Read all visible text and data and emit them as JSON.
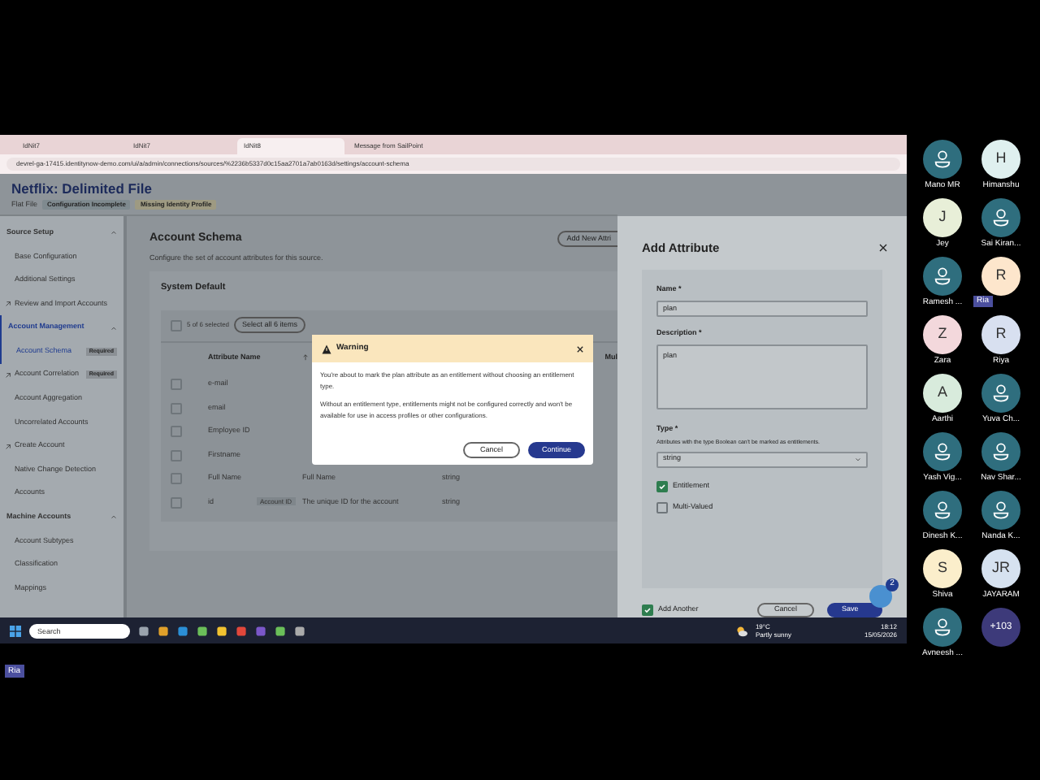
{
  "browser": {
    "tabs": [
      {
        "label": "IdNit7",
        "selected": false
      },
      {
        "label": "IdNit7",
        "selected": false
      },
      {
        "label": "IdNit8",
        "selected": true
      },
      {
        "label": "Message from SailPoint",
        "selected": false
      }
    ],
    "url": "devrel-ga-17415.identitynow-demo.com/ui/a/admin/connections/sources/%2236b5337d0c15aa2701a7ab0163d/settings/account-schema"
  },
  "source": {
    "title": "Netflix: Delimited File",
    "type": "Flat File",
    "badges": [
      "Configuration Incomplete",
      "Missing Identity Profile"
    ]
  },
  "sidebar": {
    "items": [
      {
        "kind": "section",
        "label": "Source Setup",
        "selected": false
      },
      {
        "kind": "link",
        "label": "Base Configuration",
        "selected": false
      },
      {
        "kind": "link",
        "label": "Additional Settings",
        "selected": false
      },
      {
        "kind": "action",
        "label": "Review and Import Accounts",
        "selected": false
      },
      {
        "kind": "section",
        "label": "Account Management",
        "selected": true
      },
      {
        "kind": "link",
        "label": "Account Schema",
        "selected": true,
        "badge": "Required"
      },
      {
        "kind": "action",
        "label": "Account Correlation",
        "selected": false,
        "badge": "Required"
      },
      {
        "kind": "link",
        "label": "Account Aggregation",
        "selected": false
      },
      {
        "kind": "link",
        "label": "Uncorrelated Accounts",
        "selected": false
      },
      {
        "kind": "action",
        "label": "Create Account",
        "selected": false
      },
      {
        "kind": "link",
        "label": "Native Change Detection",
        "selected": false
      },
      {
        "kind": "link",
        "label": "Accounts",
        "selected": false
      },
      {
        "kind": "section",
        "label": "Machine Accounts",
        "selected": false
      },
      {
        "kind": "link",
        "label": "Account Subtypes",
        "selected": false
      },
      {
        "kind": "link",
        "label": "Classification",
        "selected": false
      },
      {
        "kind": "link",
        "label": "Mappings",
        "selected": false
      }
    ]
  },
  "schema": {
    "title": "Account Schema",
    "description": "Configure the set of account attributes for this source.",
    "add_button": "Add New Attri",
    "card_title": "System Default",
    "selection": "5 of 6 selected",
    "all_checked": false,
    "select_all": "Select all 6 items",
    "columns": [
      "Attribute Name",
      "Mul"
    ],
    "rows": [
      {
        "name": "e-mail",
        "checked": false
      },
      {
        "name": "email",
        "checked": false
      },
      {
        "name": "Employee ID",
        "checked": false
      },
      {
        "name": "Firstname",
        "checked": false
      },
      {
        "name": "Full Name",
        "description": "Full Name",
        "type": "string",
        "checked": false
      },
      {
        "name": "id",
        "badge": "Account ID",
        "description": "The unique ID for the account",
        "type": "string",
        "checked": false
      }
    ]
  },
  "warning": {
    "title": "Warning",
    "paragraphs": [
      "You're about to mark the plan attribute as an entitlement without choosing an entitlement type.",
      "Without an entitlement type, entitlements might not be configured correctly and won't be available for use in access profiles or other configurations."
    ],
    "cancel": "Cancel",
    "continue": "Continue"
  },
  "panel": {
    "title": "Add Attribute",
    "name_label": "Name *",
    "name_value": "plan",
    "description_label": "Description *",
    "description_value": "plan",
    "type_label": "Type *",
    "type_hint": "Attributes with the type Boolean can't be marked as entitlements.",
    "type_value": "string",
    "options": [
      {
        "label": "Entitlement",
        "checked": true
      },
      {
        "label": "Multi-Valued",
        "checked": false
      }
    ],
    "add_another": {
      "label": "Add Another",
      "checked": true
    },
    "cancel": "Cancel",
    "save": "Save",
    "help_count": "2"
  },
  "taskbar": {
    "search_placeholder": "Search",
    "weather": "19°C",
    "weather_note": "Partly sunny",
    "time": "18:12",
    "date": "15/05/2026"
  },
  "participants": [
    {
      "kind": "avatar",
      "name": "Mano MR"
    },
    {
      "kind": "initial",
      "name": "Himanshu",
      "initial": "H",
      "color": "#dff0ef"
    },
    {
      "kind": "initial",
      "name": "Jey",
      "initial": "J",
      "color": "#e8efd8"
    },
    {
      "kind": "avatar",
      "name": "Sai Kiran..."
    },
    {
      "kind": "avatar",
      "name": "Ramesh ..."
    },
    {
      "kind": "initial",
      "initial": "R",
      "color": "#fde6cc",
      "tag": "Ria"
    },
    {
      "kind": "initial",
      "name": "Zara",
      "initial": "Z",
      "color": "#f3d8dc"
    },
    {
      "kind": "initial",
      "name": "Riya",
      "initial": "R",
      "color": "#d8e0f0"
    },
    {
      "kind": "initial",
      "name": "Aarthi",
      "initial": "A",
      "color": "#d8ebdc"
    },
    {
      "kind": "avatar",
      "name": "Yuva Ch..."
    },
    {
      "kind": "avatar",
      "name": "Yash Vig..."
    },
    {
      "kind": "avatar",
      "name": "Nav Shar..."
    },
    {
      "kind": "avatar",
      "name": "Dinesh K..."
    },
    {
      "kind": "avatar",
      "name": "Nanda K..."
    },
    {
      "kind": "initial",
      "name": "Shiva",
      "initial": "S",
      "color": "#fbeecb"
    },
    {
      "kind": "initial",
      "name": "JAYARAM",
      "initial": "JR",
      "color": "#d6e2f0"
    },
    {
      "kind": "avatar",
      "name": "Avneesh ..."
    },
    {
      "kind": "more",
      "initial": "+103",
      "color": "#3d3a7a"
    }
  ],
  "self_tag": "Ria"
}
